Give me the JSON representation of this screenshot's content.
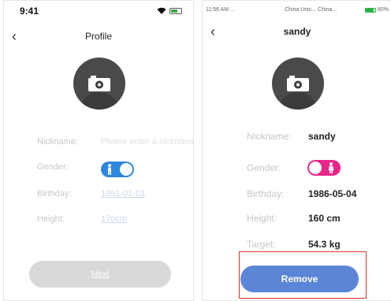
{
  "left": {
    "status_time": "9:41",
    "title": "Profile",
    "fields": {
      "nickname_label": "Nickname:",
      "nickname_placeholder": "Please enter a nickname",
      "gender_label": "Gender:",
      "birthday_label": "Birthday:",
      "birthday_value": "1991-01-01",
      "height_label": "Height:",
      "height_value": "170cm"
    },
    "gender_selected": "male",
    "next_label": "Next"
  },
  "right": {
    "status_time": "11:56 AM ...",
    "status_carriers": "China Unic... China...",
    "battery_percent": "80%",
    "title": "sandy",
    "fields": {
      "nickname_label": "Nickname:",
      "nickname_value": "sandy",
      "gender_label": "Gender:",
      "birthday_label": "Birthday:",
      "birthday_value": "1986-05-04",
      "height_label": "Height:",
      "height_value": "160 cm",
      "target_label": "Target:",
      "target_value": "54.3 kg"
    },
    "gender_selected": "female",
    "remove_label": "Remove"
  },
  "colors": {
    "male_toggle": "#2f86df",
    "female_toggle": "#e9268b",
    "remove_button": "#5b85d6",
    "highlight_frame": "#d9322d",
    "next_button_disabled": "#d9d9dc"
  }
}
